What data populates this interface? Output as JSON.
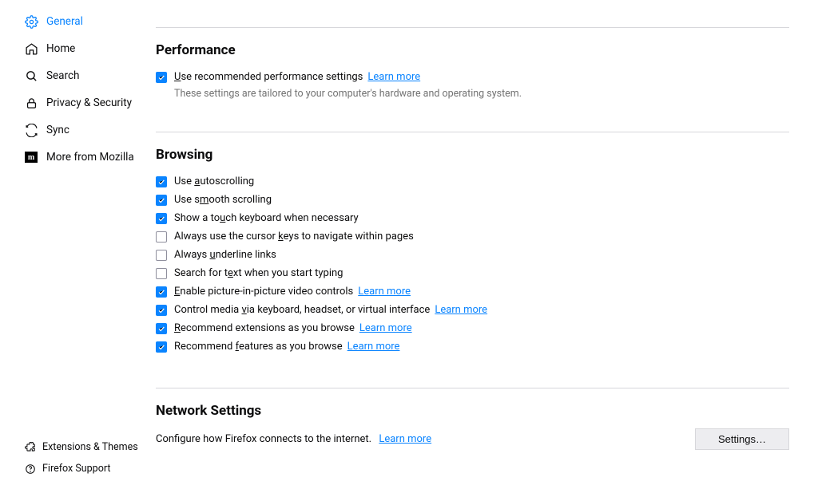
{
  "sidebar": {
    "items": [
      {
        "label": "General"
      },
      {
        "label": "Home"
      },
      {
        "label": "Search"
      },
      {
        "label": "Privacy & Security"
      },
      {
        "label": "Sync"
      },
      {
        "label": "More from Mozilla"
      }
    ],
    "bottom": [
      {
        "label": "Extensions & Themes"
      },
      {
        "label": "Firefox Support"
      }
    ]
  },
  "performance": {
    "title": "Performance",
    "use_recommended": "Use recommended performance settings",
    "learn_more": "Learn more",
    "subtext": "These settings are tailored to your computer's hardware and operating system."
  },
  "browsing": {
    "title": "Browsing",
    "autoscroll": "Use autoscrolling",
    "smooth": "Use smooth scrolling",
    "touch": "Show a touch keyboard when necessary",
    "cursor": "Always use the cursor keys to navigate within pages",
    "underline": "Always underline links",
    "typing": "Search for text when you start typing",
    "pip": "Enable picture-in-picture video controls",
    "media": "Control media via keyboard, headset, or virtual interface",
    "rec_ext": "Recommend extensions as you browse",
    "rec_feat": "Recommend features as you browse",
    "learn_more": "Learn more"
  },
  "network": {
    "title": "Network Settings",
    "desc": "Configure how Firefox connects to the internet.",
    "learn_more": "Learn more",
    "button": "Settings…"
  }
}
